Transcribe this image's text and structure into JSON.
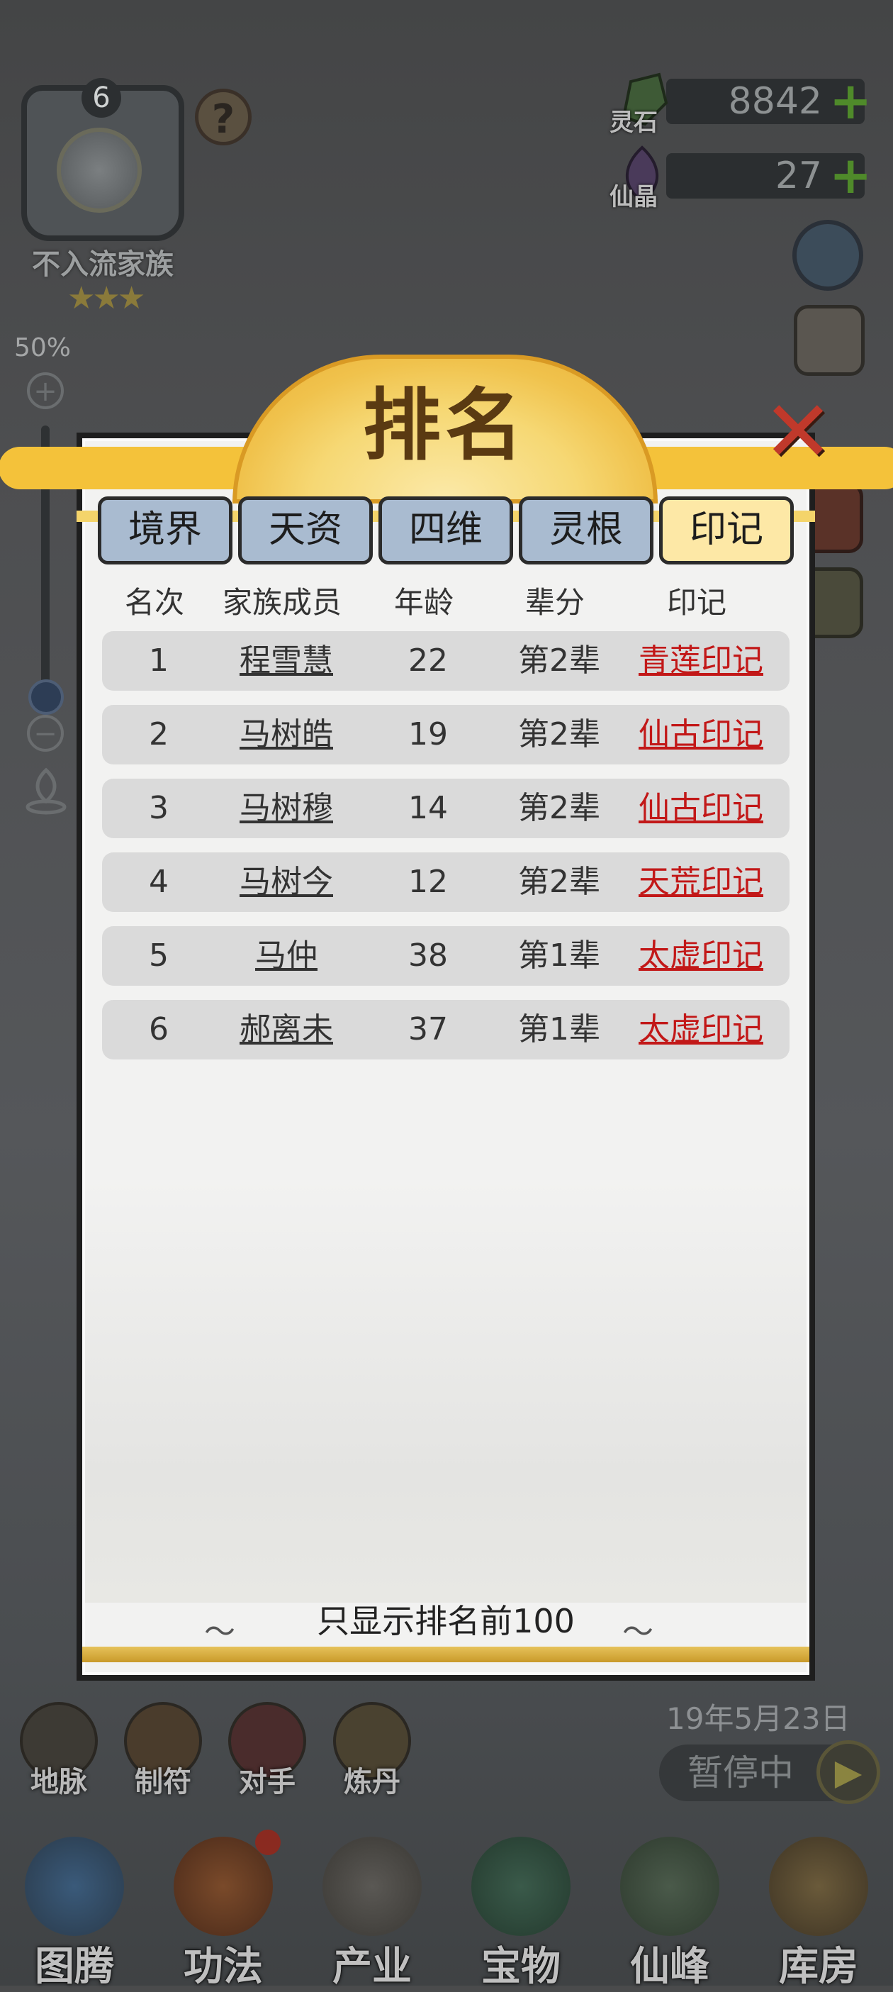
{
  "hud": {
    "family": {
      "level": "6",
      "name": "不入流家族",
      "stars": "★★★",
      "help": "?"
    },
    "currency": [
      {
        "label": "灵石",
        "value": "8842",
        "plus": "+"
      },
      {
        "label": "仙晶",
        "value": "27",
        "plus": "+"
      }
    ],
    "zoom": {
      "percent": "50%",
      "plus": "+",
      "minus": "−",
      "level": 0.1
    }
  },
  "modal": {
    "title": "排名",
    "tabs": [
      "境界",
      "天资",
      "四维",
      "灵根",
      "印记"
    ],
    "active_tab": "印记",
    "columns": [
      "名次",
      "家族成员",
      "年龄",
      "辈分",
      "印记"
    ],
    "rows": [
      {
        "rank": "1",
        "name": "程雪慧",
        "age": "22",
        "generation": "第2辈",
        "mark": "青莲印记"
      },
      {
        "rank": "2",
        "name": "马树皓",
        "age": "19",
        "generation": "第2辈",
        "mark": "仙古印记"
      },
      {
        "rank": "3",
        "name": "马树穆",
        "age": "14",
        "generation": "第2辈",
        "mark": "仙古印记"
      },
      {
        "rank": "4",
        "name": "马树今",
        "age": "12",
        "generation": "第2辈",
        "mark": "天荒印记"
      },
      {
        "rank": "5",
        "name": "马仲",
        "age": "38",
        "generation": "第1辈",
        "mark": "太虚印记"
      },
      {
        "rank": "6",
        "name": "郝离未",
        "age": "37",
        "generation": "第1辈",
        "mark": "太虚印记"
      }
    ],
    "footer": "只显示排名前100"
  },
  "quick_buttons": [
    "地脉",
    "制符",
    "对手",
    "炼丹"
  ],
  "date": "19年5月23日",
  "pause_label": "暂停中",
  "nav": [
    "图腾",
    "功法",
    "产业",
    "宝物",
    "仙峰",
    "库房"
  ],
  "colors": {
    "tab_default": "#a9bbd0",
    "tab_active": "#fde8a6",
    "mark_red": "#c21818",
    "plus_green": "#4f8a2a",
    "close_red": "#c0392b"
  }
}
